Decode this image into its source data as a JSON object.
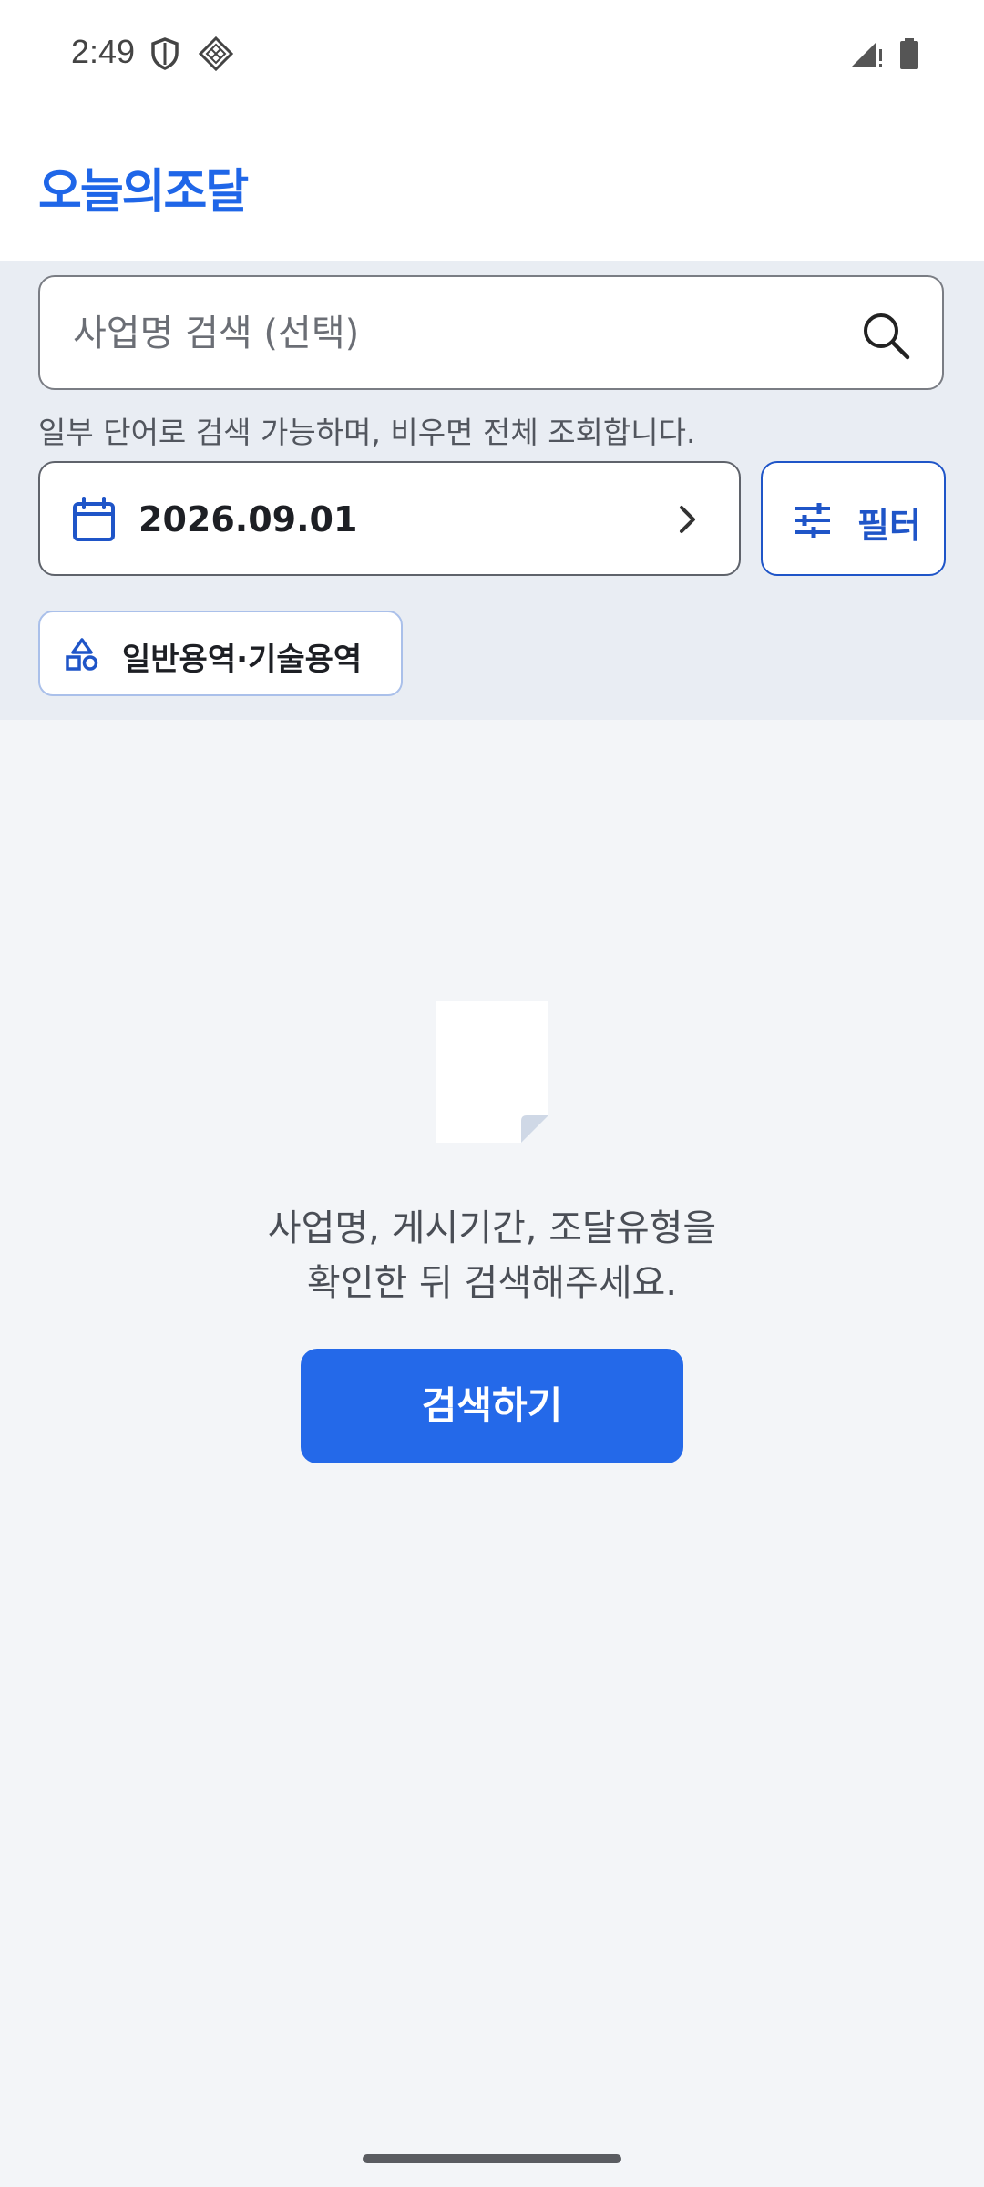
{
  "status_bar": {
    "time": "2:49",
    "icons": [
      "shield-icon",
      "diamond-grid-icon",
      "signal-icon",
      "battery-icon"
    ]
  },
  "header": {
    "app_title": "오늘의조달"
  },
  "search": {
    "placeholder": "사업명 검색 (선택)",
    "value": "",
    "helper_text": "일부 단어로 검색 가능하며, 비우면 전체 조회합니다."
  },
  "date_picker": {
    "value": "2026.09.01"
  },
  "filter_button": {
    "label": "필터"
  },
  "chip": {
    "label": "일반용역·기술용역"
  },
  "empty_state": {
    "line1": "사업명, 게시기간, 조달유형을",
    "line2": "확인한 뒤 검색해주세요.",
    "button_label": "검색하기"
  },
  "colors": {
    "brand": "#1f66e8",
    "primary_button": "#2469e9",
    "filter_accent": "#1f55c8",
    "section_background": "#e9edf3",
    "page_background": "#f3f5f8"
  }
}
